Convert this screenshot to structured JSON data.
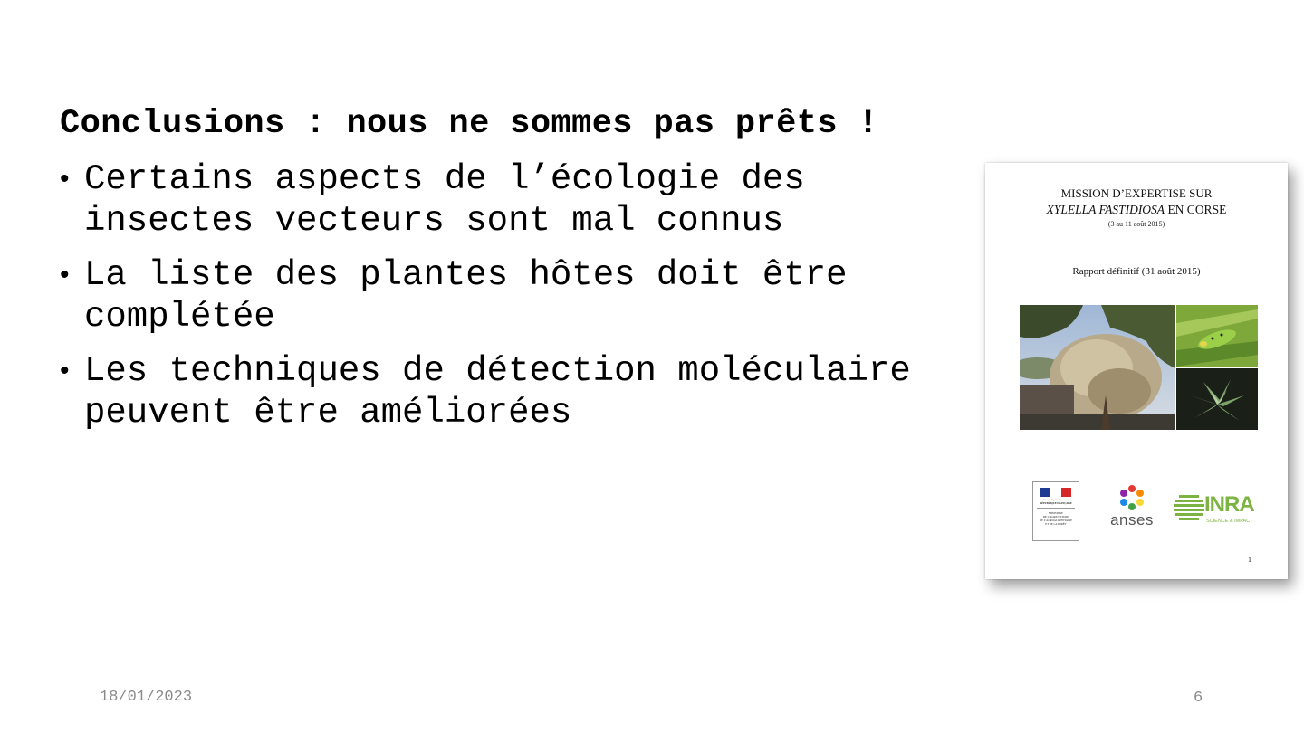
{
  "slide": {
    "title": "Conclusions : nous ne sommes pas prêts !",
    "bullets": [
      {
        "line1": "Certains aspects de l’écologie des",
        "line2": "insectes vecteurs sont mal connus"
      },
      {
        "line1": "La liste des plantes hôtes doit être",
        "line2": "complétée"
      },
      {
        "line1": "Les techniques de détection moléculaire",
        "line2": "peuvent être améliorées"
      }
    ],
    "bullet_glyph": "•",
    "footer": {
      "date": "18/01/2023",
      "page": "6"
    }
  },
  "report": {
    "title_line1": "MISSION D’EXPERTISE SUR",
    "title_line2_italic": "XYLELLA FASTIDIOSA",
    "title_line2_rest": " EN CORSE",
    "dates": "(3 au 11 août 2015)",
    "subtitle": "Rapport définitif (31 août 2015)",
    "page_number": "1",
    "logos": {
      "ministry_motto": "Liberté • Égalité • Fraternité",
      "ministry_republic": "RÉPUBLIQUE FRANÇAISE",
      "ministry_line1": "MINISTÈRE",
      "ministry_line2": "DE L’AGRICULTURE",
      "ministry_line3": "DE L’AGROALIMENTAIRE",
      "ministry_line4": "ET DE LA FORÊT",
      "anses": "anses",
      "inra": "INRA",
      "inra_tagline": "SCIENCE & IMPACT"
    }
  },
  "colors": {
    "inra_green": "#7cb342",
    "flag_blue": "#1f3a93",
    "flag_red": "#d62828",
    "footer_gray": "#8a8a8a"
  }
}
